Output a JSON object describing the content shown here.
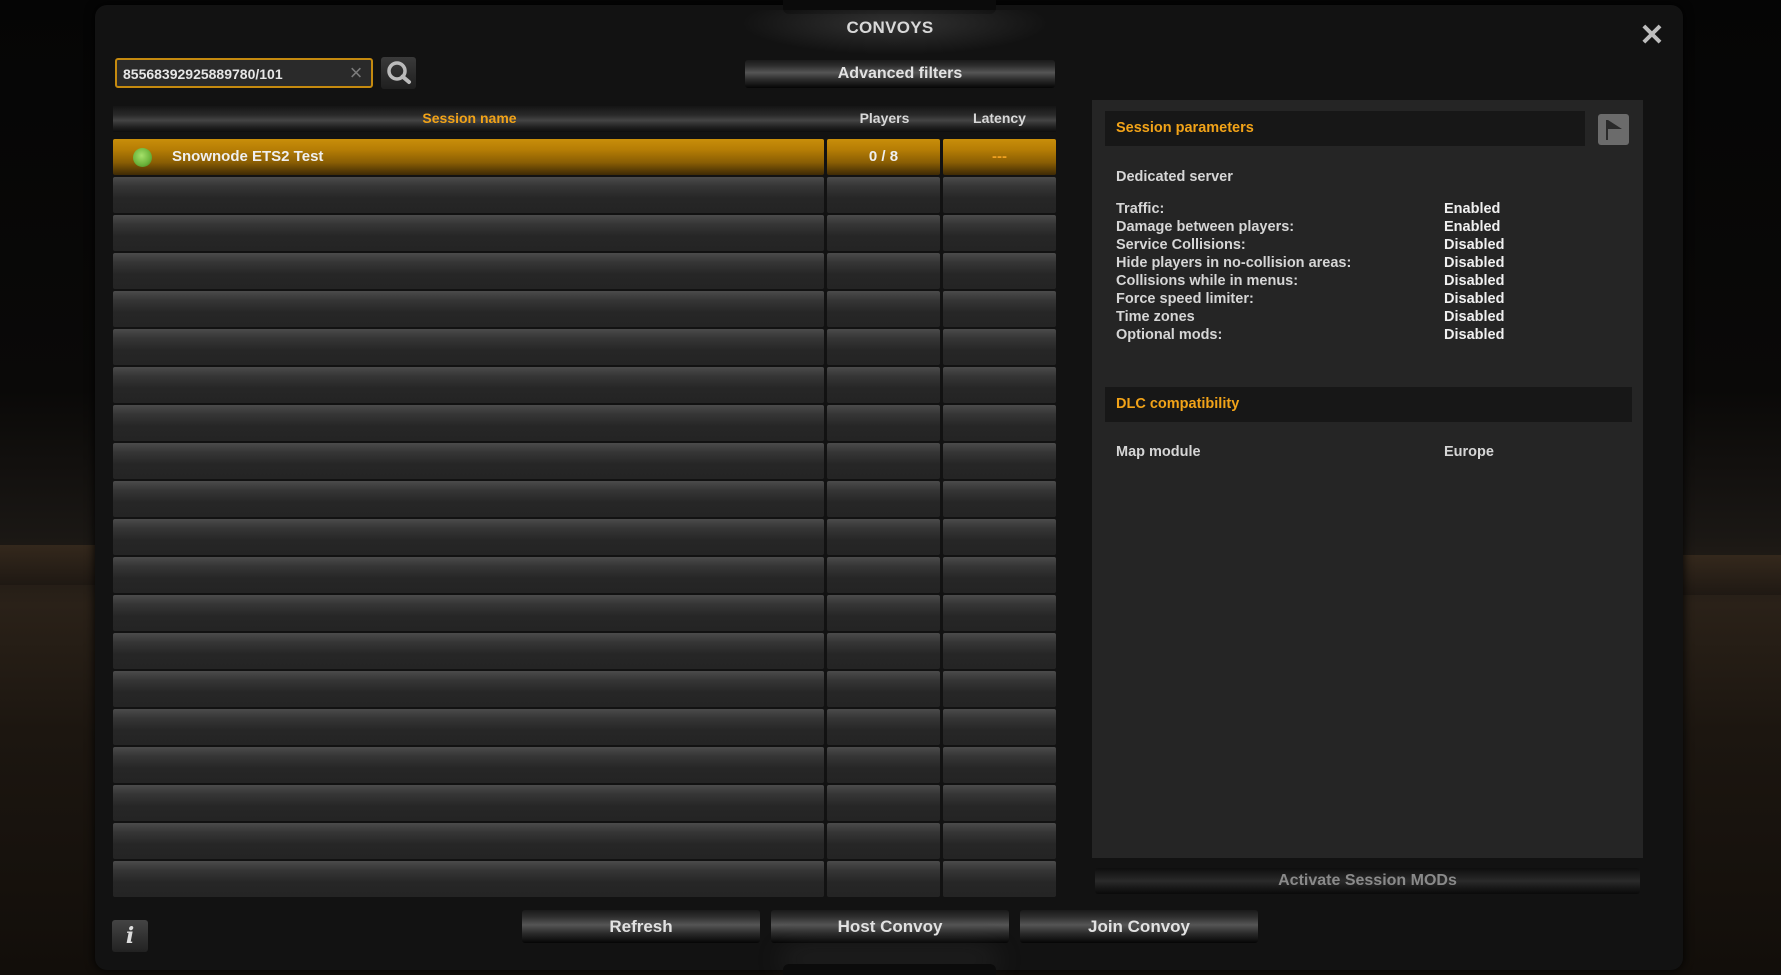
{
  "window": {
    "title": "CONVOYS",
    "close_icon": "close-icon"
  },
  "search": {
    "value": "85568392925889780/101",
    "placeholder": "",
    "clear_icon": "clear-icon",
    "search_icon": "magnifier-icon"
  },
  "toolbar": {
    "advanced_filters_label": "Advanced filters"
  },
  "table": {
    "columns": [
      "Session name",
      "Players",
      "Latency"
    ],
    "rows": [
      {
        "status": "online",
        "status_color": "#6bb33a",
        "name": "Snownode ETS2 Test",
        "players": "0 / 8",
        "latency": "---",
        "selected": true
      }
    ],
    "empty_row_count": 19
  },
  "details": {
    "session_parameters_title": "Session parameters",
    "report_icon": "flag-icon",
    "server_type": "Dedicated server",
    "parameters": [
      {
        "label": "Traffic:",
        "value": "Enabled"
      },
      {
        "label": "Damage between players:",
        "value": "Enabled"
      },
      {
        "label": "Service Collisions:",
        "value": "Disabled"
      },
      {
        "label": "Hide players in no-collision areas:",
        "value": "Disabled"
      },
      {
        "label": "Collisions while in menus:",
        "value": "Disabled"
      },
      {
        "label": "Force speed limiter:",
        "value": "Disabled"
      },
      {
        "label": "Time zones",
        "value": "Disabled"
      },
      {
        "label": "Optional mods:",
        "value": "Disabled"
      }
    ],
    "dlc_title": "DLC compatibility",
    "dlc": [
      {
        "label": "Map module",
        "value": "Europe"
      }
    ]
  },
  "activate_mods_label": "Activate Session MODs",
  "footer": {
    "info_label": "i",
    "refresh_label": "Refresh",
    "host_label": "Host Convoy",
    "join_label": "Join Convoy"
  },
  "colors": {
    "accent": "#f2a318",
    "selected_row": "#c98e0a",
    "search_border": "#c58a0f"
  }
}
